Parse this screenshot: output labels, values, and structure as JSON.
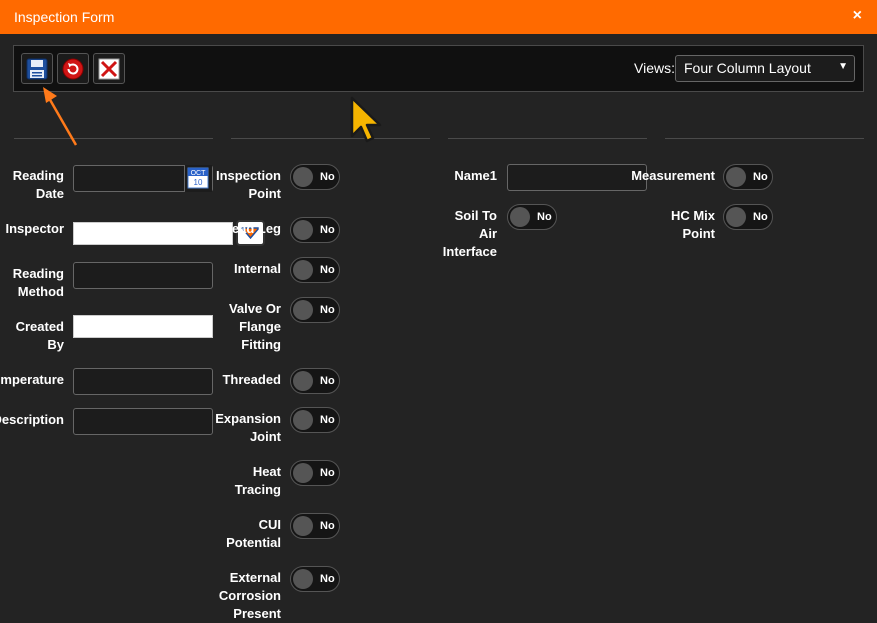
{
  "window": {
    "title": "Inspection Form",
    "close": "×"
  },
  "toolbar": {
    "buttons": [
      {
        "icon": "save-icon"
      },
      {
        "icon": "refresh-icon"
      },
      {
        "icon": "cancel-icon"
      }
    ],
    "views_label": "Views:",
    "views_value": "Four Column Layout",
    "views_caret": "▼"
  },
  "calendar_icon": {
    "month": "OCT",
    "day": "10"
  },
  "col1": {
    "reading_date": "Reading\nDate",
    "inspector": "Inspector",
    "reading_method": "Reading\nMethod",
    "created_by": "Created\nBy",
    "temperature": "Temperature",
    "description": "Description"
  },
  "col2": {
    "inspection_point": "Inspection\nPoint",
    "dead_leg": "Dead Leg",
    "internal": "Internal",
    "valve_or_flange_fitting": "Valve Or\nFlange\nFitting",
    "threaded": "Threaded",
    "expansion_joint": "Expansion\nJoint",
    "heat_tracing": "Heat\nTracing",
    "cui_potential": "CUI\nPotential",
    "external_corrosion_present": "External\nCorrosion\nPresent"
  },
  "col3": {
    "name1": "Name1",
    "soil_to_air_interface": "Soil To\nAir\nInterface"
  },
  "col4": {
    "measurement": "Measurement",
    "hc_mix_point": "HC Mix\nPoint"
  },
  "toggle_off_text": "No",
  "colors": {
    "accent": "#ff6a00",
    "background": "#232323",
    "toolbar": "#101010"
  }
}
